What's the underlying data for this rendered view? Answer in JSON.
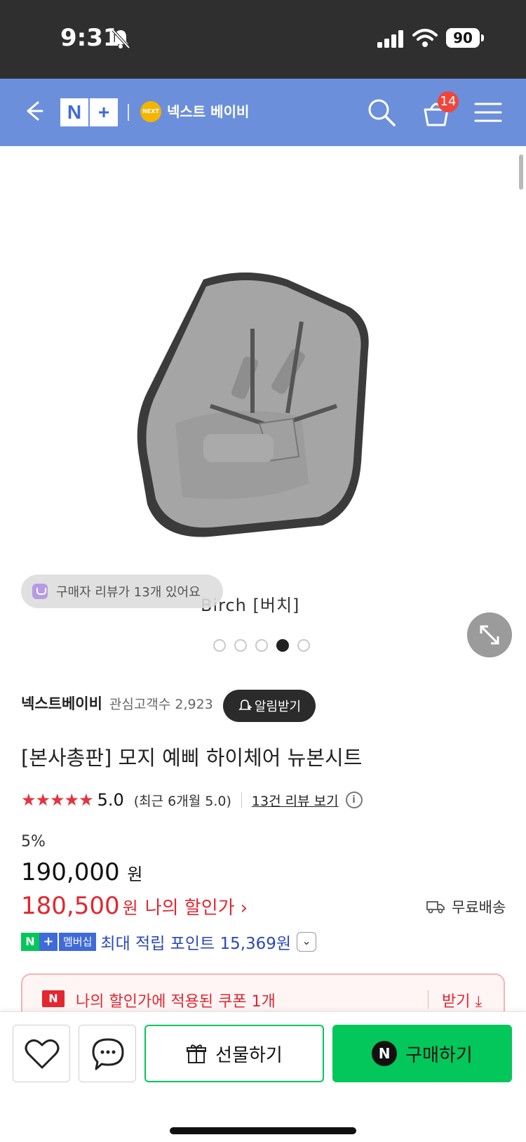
{
  "status_bar": {
    "time": "9:31",
    "battery": "90",
    "icons": [
      "bell-off-icon",
      "signal-icon",
      "wifi-icon",
      "battery-icon"
    ]
  },
  "header": {
    "logo": "N+",
    "store_badge": "NEXT",
    "store_name": "넥스트 베이비",
    "cart_count": "14",
    "icons": [
      "back-arrow-icon",
      "search-icon",
      "cart-icon",
      "menu-icon"
    ],
    "bg_color": "#6b8fdb"
  },
  "hero": {
    "variant_caption": "Birch [버치]",
    "review_pill": "구매자 리뷰가 13개 있어요",
    "dots_total": 5,
    "dots_active": 4
  },
  "product": {
    "seller_name": "넥스트베이비",
    "interest_label": "관심고객수 2,923",
    "notify_label": "알림받기",
    "title": "[본사총판] 모지 예삐 하이체어 뉴본시트",
    "stars": "★★★★★",
    "rating": "5.0",
    "rating_recent": "(최근 6개월 5.0)",
    "review_link": "13건 리뷰 보기",
    "discount_rate": "5%",
    "original_price": "190,000",
    "original_unit": "원",
    "sale_price": "180,500",
    "sale_unit": "원",
    "my_price_label": "나의 할인가",
    "free_shipping": "무료배송",
    "np_member_label": "멤버십",
    "point_text": "최대 적립 포인트 15,369원",
    "coupon_text": "나의 할인가에 적용된 쿠폰 1개",
    "coupon_get": "받기",
    "accent_red": "#e3262f",
    "accent_green": "#03c75a"
  },
  "bottom_bar": {
    "gift_label": "선물하기",
    "buy_label": "구매하기"
  }
}
